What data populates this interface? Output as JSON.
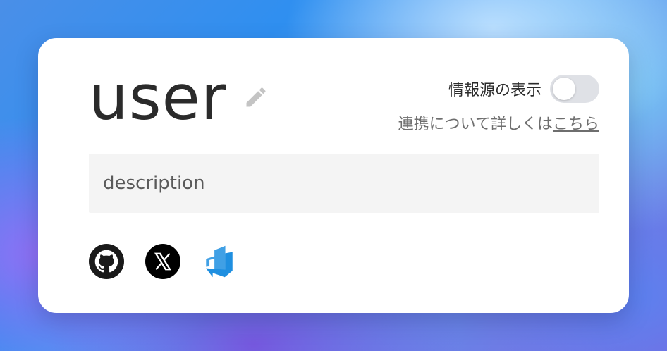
{
  "profile": {
    "username": "user",
    "description_placeholder": "description"
  },
  "source_toggle": {
    "label": "情報源の表示",
    "enabled": false
  },
  "integration": {
    "text": "連携について詳しくは",
    "link_text": "こちら"
  },
  "social_links": [
    {
      "icon": "github-icon"
    },
    {
      "icon": "x-icon"
    },
    {
      "icon": "azure-devops-icon"
    }
  ],
  "colors": {
    "card_background": "#ffffff",
    "text": "#2b2b2b",
    "muted_text": "#6e6e6e",
    "toggle_off": "#dfe1e6",
    "input_background": "#f4f4f4",
    "azure_blue": "#1f8fe0"
  }
}
